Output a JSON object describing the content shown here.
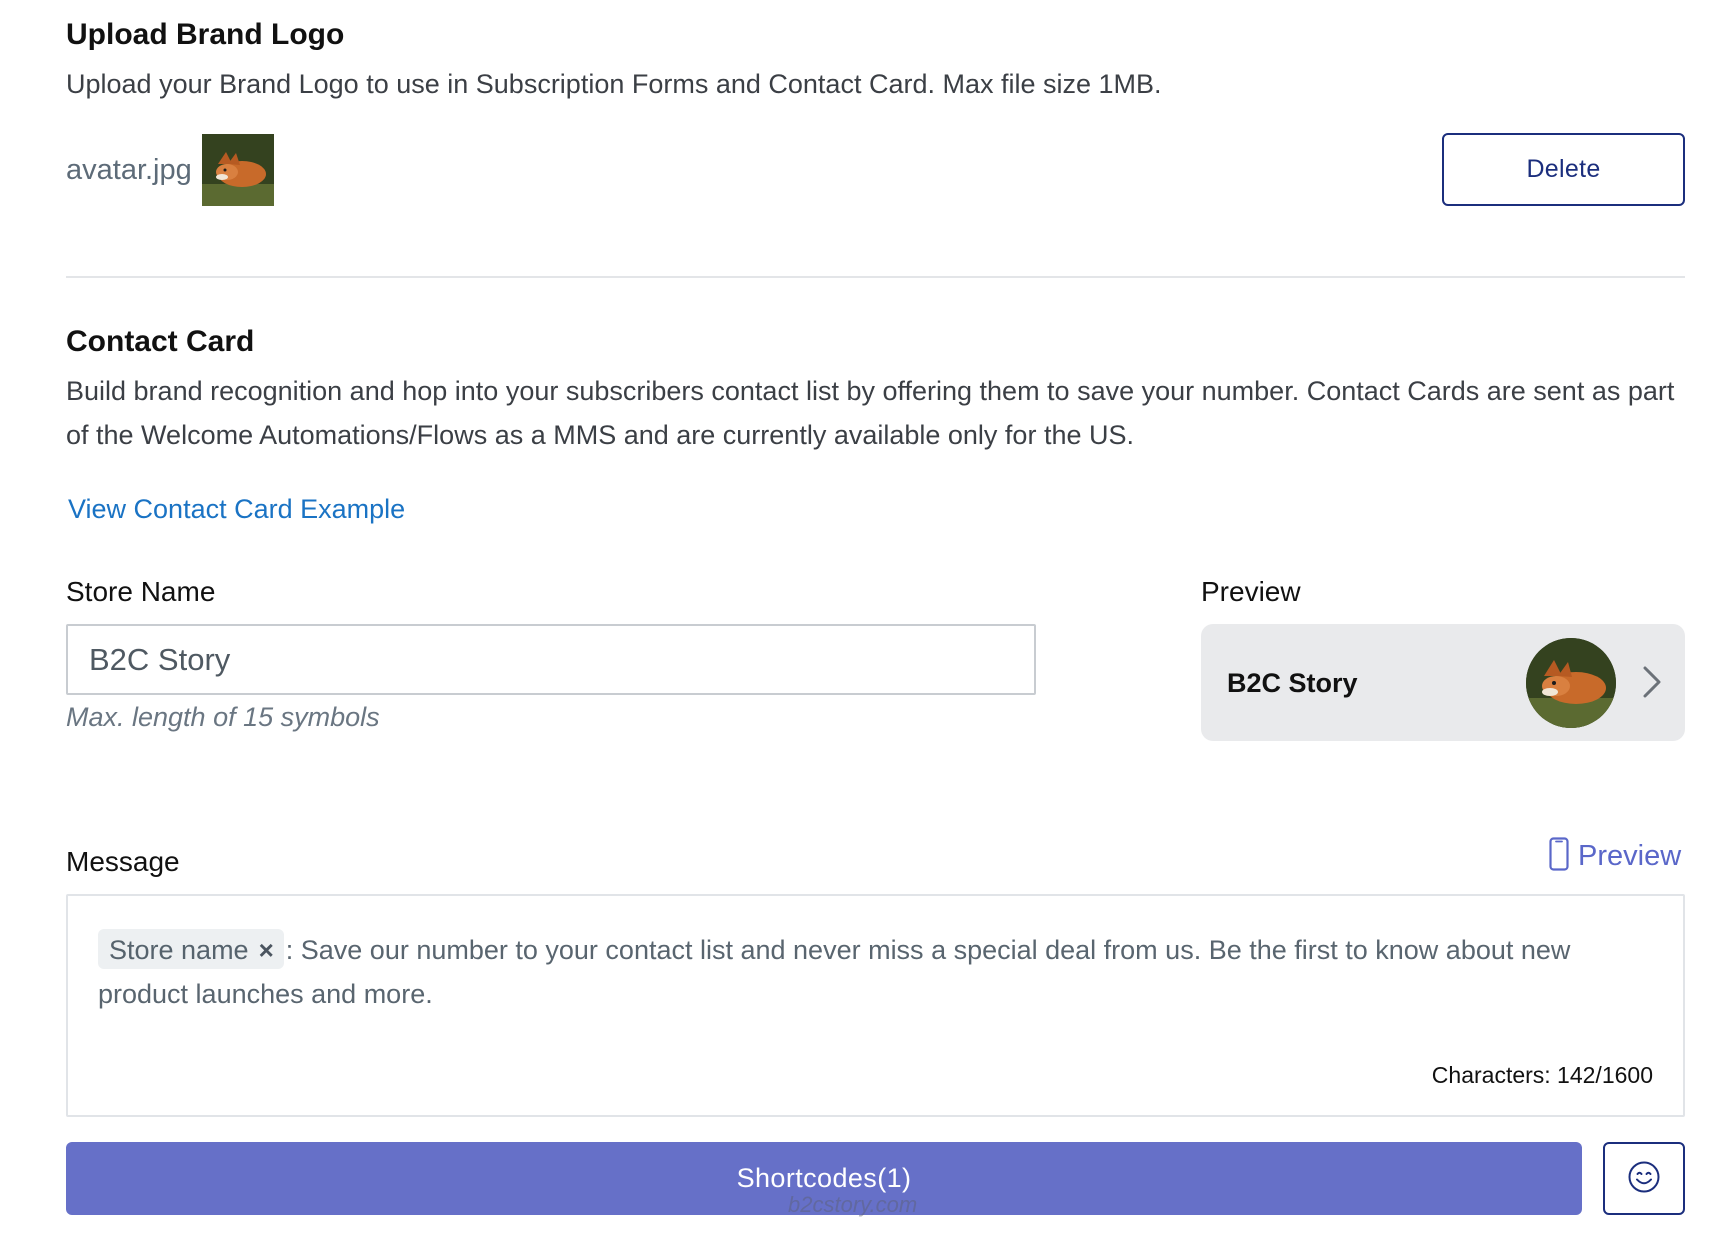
{
  "upload": {
    "title": "Upload Brand Logo",
    "description": "Upload your Brand Logo to use in Subscription Forms and Contact Card. Max file size 1MB.",
    "file_name": "avatar.jpg",
    "delete_label": "Delete"
  },
  "contact_card": {
    "title": "Contact Card",
    "description": "Build brand recognition and hop into your subscribers contact list by offering them to save your number. Contact Cards are sent as part of the Welcome Automations/Flows as a MMS and are currently available only for the US.",
    "example_link": "View Contact Card Example"
  },
  "store_name": {
    "label": "Store Name",
    "value": "B2C Story",
    "hint": "Max. length of 15 symbols"
  },
  "preview": {
    "label": "Preview",
    "store_name": "B2C Story"
  },
  "message": {
    "label": "Message",
    "preview_link": "Preview",
    "tag_label": "Store name",
    "tag_remove": "×",
    "text": ": Save our number to your contact list and never miss a special deal from us. Be the first to know about new product launches and more.",
    "char_count": "Characters: 142/1600"
  },
  "actions": {
    "shortcodes_label": "Shortcodes(1)",
    "emoji_icon": "smiley-icon"
  },
  "watermark": "b2cstory.com",
  "colors": {
    "primary_navy": "#1b2e7d",
    "link_blue": "#1a73c4",
    "shortcodes_purple": "#6670c8",
    "preview_link": "#5a67c9"
  }
}
